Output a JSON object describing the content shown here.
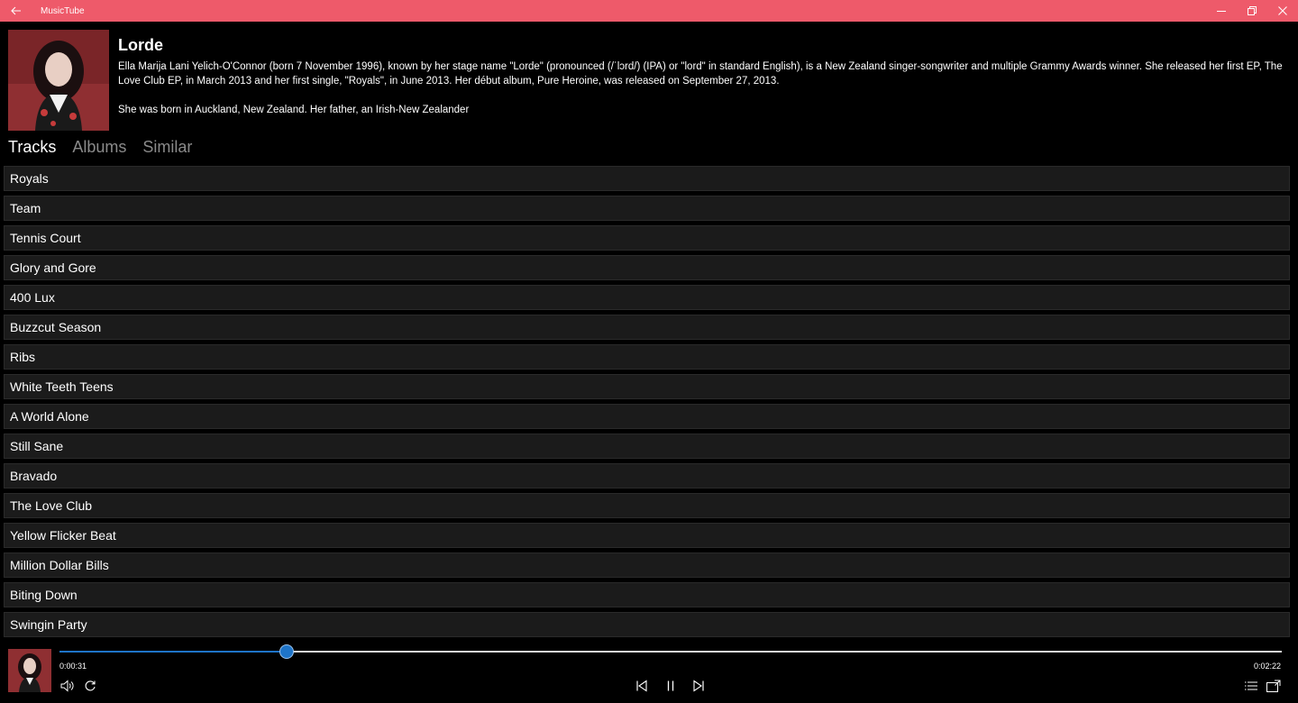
{
  "window": {
    "title": "MusicTube",
    "back_icon": "back-arrow-icon",
    "controls": [
      "minimize-icon",
      "restore-icon",
      "close-icon"
    ],
    "accent": "#ee5a6a"
  },
  "artist": {
    "name": "Lorde",
    "bio_paragraphs": [
      "Ella Marija Lani Yelich-O'Connor (born 7 November 1996), known by her stage name \"Lorde\" (pronounced (/ˈlɔrd/) (IPA) or \"lord\" in standard English), is a New Zealand singer-songwriter and multiple Grammy Awards winner. She released her first EP, The Love Club EP, in March 2013 and her first single, \"Royals\", in June 2013. Her début album, Pure Heroine, was released on September 27, 2013.",
      "She was born in Auckland, New Zealand. Her father, an Irish-New Zealander"
    ]
  },
  "tabs": [
    {
      "label": "Tracks",
      "active": true
    },
    {
      "label": "Albums",
      "active": false
    },
    {
      "label": "Similar",
      "active": false
    }
  ],
  "tracks": [
    "Royals",
    "Team",
    "Tennis Court",
    "Glory and Gore",
    "400 Lux",
    "Buzzcut Season",
    "Ribs",
    "White Teeth Teens",
    "A World Alone",
    "Still Sane",
    "Bravado",
    "The Love Club",
    "Yellow Flicker Beat",
    "Million Dollar Bills",
    "Biting Down",
    "Swingin Party"
  ],
  "player": {
    "current_time": "0:00:31",
    "total_time": "0:02:22",
    "progress_fraction": 0.186,
    "seek_color": "#1e74c8",
    "icons": {
      "volume": "volume-icon",
      "repeat": "repeat-icon",
      "previous": "previous-track-icon",
      "pause": "pause-icon",
      "next": "next-track-icon",
      "queue": "playlist-icon",
      "miniview": "compact-overlay-icon"
    }
  }
}
